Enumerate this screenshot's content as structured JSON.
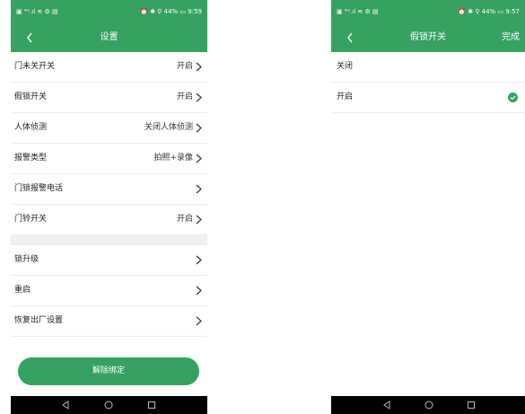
{
  "left": {
    "status_left": "▣ ⁴ᴳ.ıl ≋ ⚙ ▤",
    "status_right": "⏰ ✱ ⚲ 44% ▭ 9:59",
    "title": "设置",
    "rows": [
      {
        "label": "门未关开关",
        "value": "开启"
      },
      {
        "label": "假锁开关",
        "value": "开启"
      },
      {
        "label": "人体侦测",
        "value": "关闭人体侦测"
      },
      {
        "label": "报警类型",
        "value": "拍照+录像"
      },
      {
        "label": "门锁报警电话",
        "value": ""
      },
      {
        "label": "门铃开关",
        "value": "开启"
      }
    ],
    "rows2": [
      {
        "label": "锁升级"
      },
      {
        "label": "重启"
      },
      {
        "label": "恢复出厂设置"
      }
    ],
    "unbind_label": "解除绑定"
  },
  "right": {
    "status_left": "▣ ⁴ᴳ.ıl ≋ ⚙ ▤",
    "status_right": "⏰ ✱ ⚲ 44% ▭ 9:57",
    "title": "假锁开关",
    "done_label": "完成",
    "options": [
      {
        "label": "关闭",
        "selected": false
      },
      {
        "label": "开启",
        "selected": true
      }
    ]
  },
  "colors": {
    "accent": "#35a261",
    "divider": "#ececec",
    "navkeys": "#000000"
  },
  "icons": [
    "back-chevron-icon",
    "chevron-right-icon",
    "check-circle-icon",
    "back-triangle-icon",
    "home-circle-icon",
    "recents-square-icon"
  ]
}
